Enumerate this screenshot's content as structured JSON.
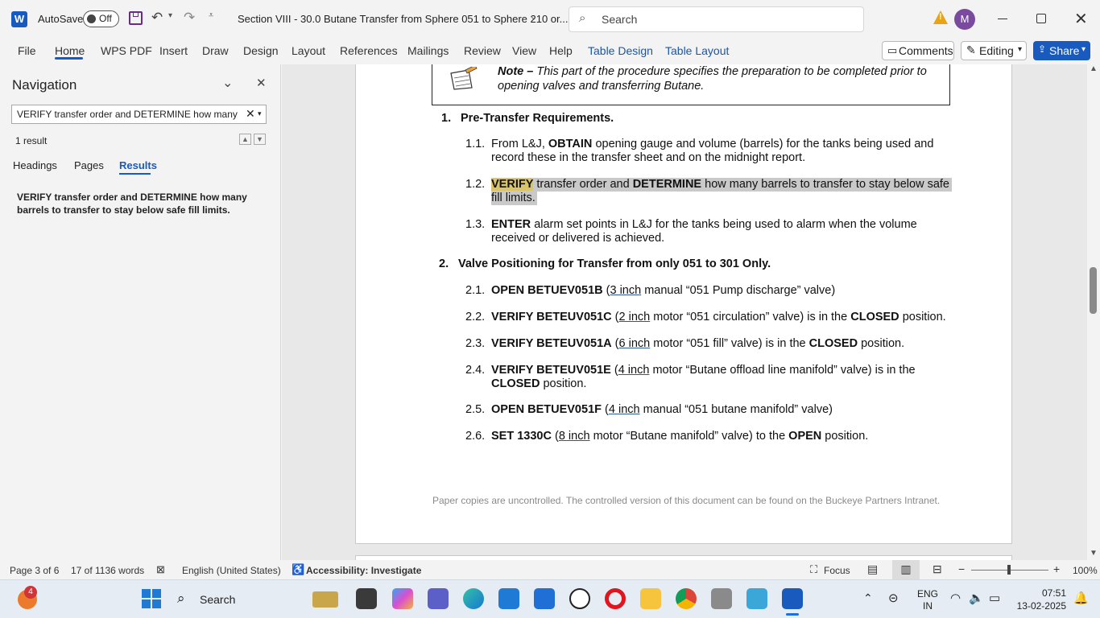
{
  "titlebar": {
    "autosave_label": "AutoSave",
    "autosave_state": "Off",
    "document_title": "Section VIII - 30.0 Butane Transfer from Sphere 051 to Sphere 210 or...",
    "search_placeholder": "Search",
    "avatar_initial": "M"
  },
  "ribbon": {
    "tabs": [
      "File",
      "Home",
      "WPS PDF",
      "Insert",
      "Draw",
      "Design",
      "Layout",
      "References",
      "Mailings",
      "Review",
      "View",
      "Help",
      "Table Design",
      "Table Layout"
    ],
    "comments_label": "Comments",
    "editing_label": "Editing",
    "share_label": "Share"
  },
  "navigation": {
    "title": "Navigation",
    "search_value": "VERIFY transfer order and DETERMINE how many ba",
    "result_count": "1 result",
    "tabs": [
      "Headings",
      "Pages",
      "Results"
    ],
    "active_tab": "Results",
    "result_line1": "VERIFY transfer order and DETERMINE how many",
    "result_line2": "barrels to transfer to stay below safe fill limits."
  },
  "document": {
    "note_label": "Note –",
    "note_line1": "This part of the procedure specifies the preparation to be completed prior to",
    "note_line2": "opening valves and transferring Butane.",
    "sec1_num": "1.",
    "sec1_title": "Pre-Transfer Requirements.",
    "s11_num": "1.1.",
    "s11_a": "From L&J,",
    "s11_b": "OBTAIN",
    "s11_c": "opening gauge and volume (barrels) for the tanks being used and",
    "s11_line2": "record these in the transfer sheet and on the midnight report.",
    "s12_num": "1.2.",
    "s12_a": "VERIFY",
    "s12_b": "transfer order and",
    "s12_c": "DETERMINE",
    "s12_d": "how many barrels to transfer to stay below safe",
    "s12_line2": "fill limits.",
    "s13_num": "1.3.",
    "s13_a": "ENTER",
    "s13_b": "alarm set points in L&J for the tanks being used to alarm when the volume",
    "s13_line2": "received or delivered is achieved.",
    "sec2_num": "2.",
    "sec2_title": "Valve Positioning for Transfer from only 051 to 301 Only.",
    "s21_num": "2.1.",
    "s21_a": "OPEN BETUEV051B",
    "s21_b": "(",
    "s21_c": "3 inch",
    "s21_d": "manual “051 Pump discharge” valve)",
    "s22_num": "2.2.",
    "s22_a": "VERIFY BETEUV051C",
    "s22_b": "(",
    "s22_c": "2 inch",
    "s22_d": "motor “051 circulation” valve) is in the",
    "s22_e": "CLOSED",
    "s22_f": "position.",
    "s23_num": "2.3.",
    "s23_a": "VERIFY BETEUV051A",
    "s23_b": "(",
    "s23_c": "6 inch",
    "s23_d": "motor “051 fill” valve) is in the",
    "s23_e": "CLOSED",
    "s23_f": "position.",
    "s24_num": "2.4.",
    "s24_a": "VERIFY BETEUV051E",
    "s24_b": "(",
    "s24_c": "4 inch",
    "s24_d": "motor “Butane offload line manifold” valve) is in the",
    "s24_e": "CLOSED",
    "s24_f": "position.",
    "s25_num": "2.5.",
    "s25_a": "OPEN BETUEV051F",
    "s25_b": "(",
    "s25_c": "4 inch",
    "s25_d": "manual “051 butane manifold” valve)",
    "s26_num": "2.6.",
    "s26_a": "SET 1330C",
    "s26_b": "(",
    "s26_c": "8 inch",
    "s26_d": "motor “Butane manifold” valve) to the",
    "s26_e": "OPEN",
    "s26_f": "position.",
    "footer": "Paper copies are uncontrolled. The controlled version of this document can be found on the Buckeye Partners Intranet."
  },
  "statusbar": {
    "page": "Page 3 of 6",
    "words": "17 of 1136 words",
    "language": "English (United States)",
    "accessibility": "Accessibility: Investigate",
    "focus": "Focus",
    "zoom": "100%"
  },
  "taskbar": {
    "notification_count": "4",
    "search_label": "Search",
    "language_line1": "ENG",
    "language_line2": "IN",
    "time": "07:51",
    "date": "13-02-2025"
  },
  "colors": {
    "accent": "#1a56a8",
    "highlight_yellow": "#d9c46a",
    "highlight_gray": "#c9c9c9",
    "word_blue": "#185abd",
    "warning": "#e8a317"
  }
}
